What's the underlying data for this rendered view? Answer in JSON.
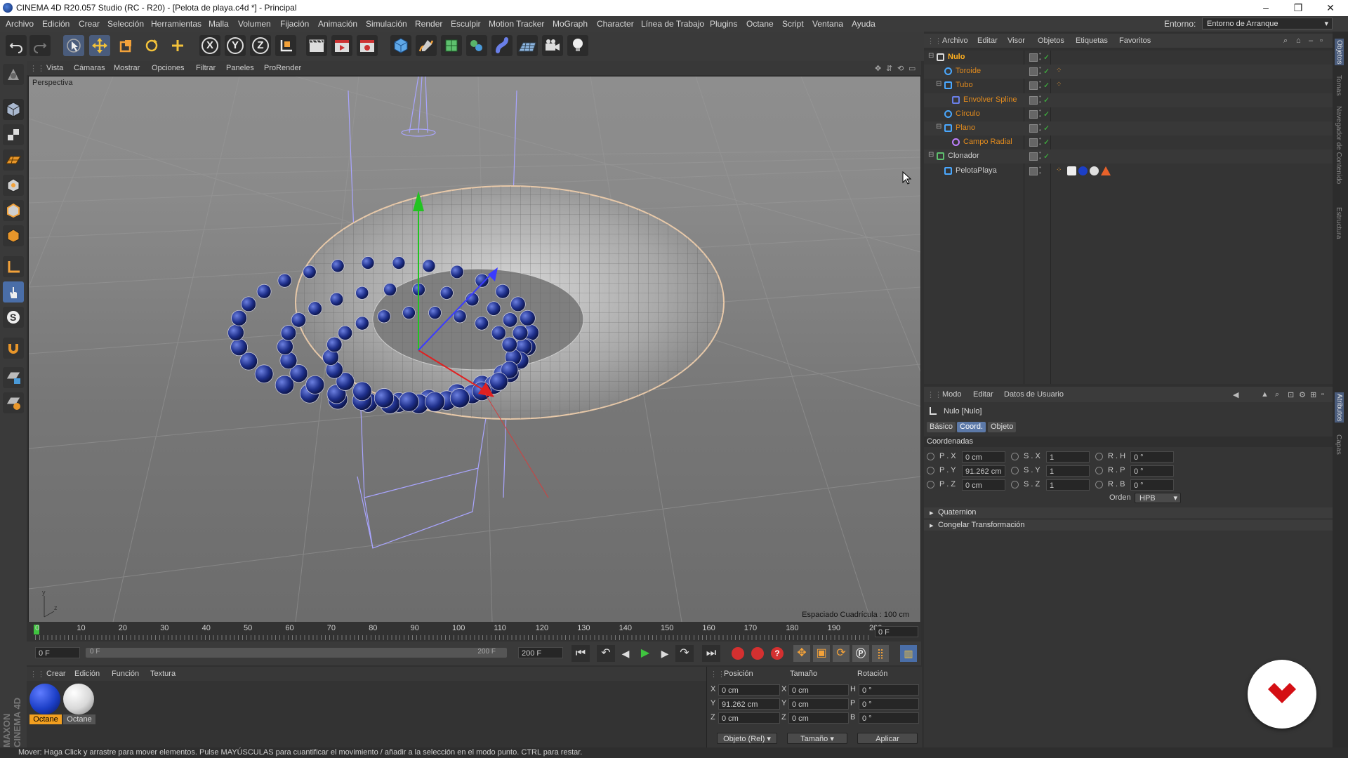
{
  "window": {
    "title": "CINEMA 4D R20.057 Studio (RC - R20) - [Pelota de playa.c4d *] - Principal",
    "min": "–",
    "max": "❐",
    "close": "✕"
  },
  "menu": [
    "Archivo",
    "Edición",
    "Crear",
    "Selección",
    "Herramientas",
    "Malla",
    "Volumen",
    "Fijación",
    "Animación",
    "Simulación",
    "Render",
    "Esculpir",
    "Motion Tracker",
    "MoGraph",
    "Character",
    "Línea de Trabajo",
    "Plugins",
    "Octane",
    "Script",
    "Ventana",
    "Ayuda"
  ],
  "environment": {
    "label": "Entorno:",
    "value": "Entorno de Arranque"
  },
  "toolbar_axes": {
    "x": "X",
    "y": "Y",
    "z": "Z"
  },
  "viewport": {
    "menu": [
      "Vista",
      "Cámaras",
      "Mostrar",
      "Opciones",
      "Filtrar",
      "Paneles",
      "ProRender"
    ],
    "camera_label": "Perspectiva",
    "grid_spacing": "Espaciado Cuadrícula : 100 cm"
  },
  "timeline": {
    "ticks": [
      "0",
      "10",
      "20",
      "30",
      "40",
      "50",
      "60",
      "70",
      "80",
      "90",
      "100",
      "110",
      "120",
      "130",
      "140",
      "150",
      "160",
      "170",
      "180",
      "190",
      "200"
    ],
    "current_frame": "0 F"
  },
  "playback": {
    "start": "0 F",
    "range_start": "0 F",
    "range_end": "200 F",
    "end": "200 F"
  },
  "materials": {
    "menu": [
      "Crear",
      "Edición",
      "Función",
      "Textura"
    ],
    "items": [
      {
        "name": "Octane",
        "color": "#1c3fc7"
      },
      {
        "name": "Octane",
        "color": "#d8d8d8"
      }
    ],
    "brand_text": "MAXON CINEMA 4D"
  },
  "coords": {
    "headers": {
      "pos": "Posición",
      "size": "Tamaño",
      "rot": "Rotación"
    },
    "rows": [
      {
        "a": "X",
        "pos": "0 cm",
        "b": "X",
        "size": "0 cm",
        "c": "H",
        "rot": "0 °"
      },
      {
        "a": "Y",
        "pos": "91.262 cm",
        "b": "Y",
        "size": "0 cm",
        "c": "P",
        "rot": "0 °"
      },
      {
        "a": "Z",
        "pos": "0 cm",
        "b": "Z",
        "size": "0 cm",
        "c": "B",
        "rot": "0 °"
      }
    ],
    "mode": "Objeto (Rel)",
    "size_mode": "Tamaño",
    "apply": "Aplicar"
  },
  "objects_panel": {
    "menu": [
      "Archivo",
      "Editar",
      "Visor",
      "Objetos",
      "Etiquetas",
      "Favoritos"
    ],
    "items": [
      {
        "name": "Nulo",
        "depth": 0,
        "color": "#ffb020",
        "bold": true,
        "expander": "⊟"
      },
      {
        "name": "Toroide",
        "depth": 1,
        "color": "#e08a1e",
        "expander": ""
      },
      {
        "name": "Tubo",
        "depth": 1,
        "color": "#e08a1e",
        "expander": "⊟"
      },
      {
        "name": "Envolver Spline",
        "depth": 2,
        "color": "#e08a1e",
        "expander": ""
      },
      {
        "name": "Círculo",
        "depth": 1,
        "color": "#e08a1e",
        "expander": ""
      },
      {
        "name": "Plano",
        "depth": 1,
        "color": "#e08a1e",
        "expander": "⊟"
      },
      {
        "name": "Campo Radial",
        "depth": 2,
        "color": "#e08a1e",
        "expander": ""
      },
      {
        "name": "Clonador",
        "depth": 0,
        "color": "#d0d0d0",
        "expander": "⊟"
      },
      {
        "name": "PelotaPlaya",
        "depth": 1,
        "color": "#d0d0d0",
        "expander": ""
      }
    ]
  },
  "attributes": {
    "menu": [
      "Modo",
      "Editar",
      "Datos de Usuario"
    ],
    "object_title": "Nulo [Nulo]",
    "tabs": [
      "Básico",
      "Coord.",
      "Objeto"
    ],
    "section": "Coordenadas",
    "fields": [
      {
        "pl": "P . X",
        "pv": "0 cm",
        "sl": "S . X",
        "sv": "1",
        "rl": "R . H",
        "rv": "0 °"
      },
      {
        "pl": "P . Y",
        "pv": "91.262 cm",
        "sl": "S . Y",
        "sv": "1",
        "rl": "R . P",
        "rv": "0 °"
      },
      {
        "pl": "P . Z",
        "pv": "0 cm",
        "sl": "S . Z",
        "sv": "1",
        "rl": "R . B",
        "rv": "0 °"
      }
    ],
    "order_label": "Orden",
    "order_value": "HPB",
    "groups": [
      "Quaternion",
      "Congelar Transformación"
    ]
  },
  "right_strip_tabs": [
    "Objetos",
    "Tomas",
    "Navegador de Contenido",
    "Estructura",
    "Atributos",
    "Capas"
  ],
  "status": "Mover: Haga Click y arrastre para mover elementos. Pulse MAYÚSCULAS para cuantificar el movimiento / añadir a la selección en el modo punto. CTRL para restar."
}
